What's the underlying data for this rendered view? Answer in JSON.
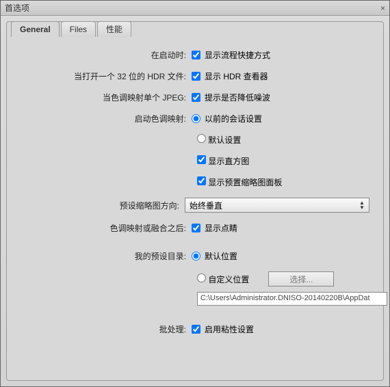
{
  "window": {
    "title": "首选项"
  },
  "tabs": {
    "general": "General",
    "files": "Files",
    "perf": "性能"
  },
  "labels": {
    "onStartup": "在启动时:",
    "openHdr": "当打开一个 32 位的 HDR 文件:",
    "singleJpeg": "当色调映射单个 JPEG:",
    "startTone": "启动色调映射:",
    "orientation": "预设缩略图方向:",
    "afterTone": "色调映射或融合之后:",
    "presetDir": "我的预设目录:",
    "batch": "批处理:"
  },
  "options": {
    "showWorkflow": "显示流程快捷方式",
    "showHdrViewer": "显示 HDR 查看器",
    "promptNoise": "提示是否降低噪波",
    "prevSession": "以前的会话设置",
    "defaultSettings": "默认设置",
    "showHistogram": "显示直方图",
    "showPresetPanel": "显示预置缩略图面板",
    "orientationValue": "始终垂直",
    "showFinish": "显示点睛",
    "defaultLocation": "默认位置",
    "customLocation": "自定义位置",
    "browse": "选择...",
    "enableSticky": "启用粘性设置"
  },
  "path": "C:\\Users\\Administrator.DNISO-20140220B\\AppDat"
}
